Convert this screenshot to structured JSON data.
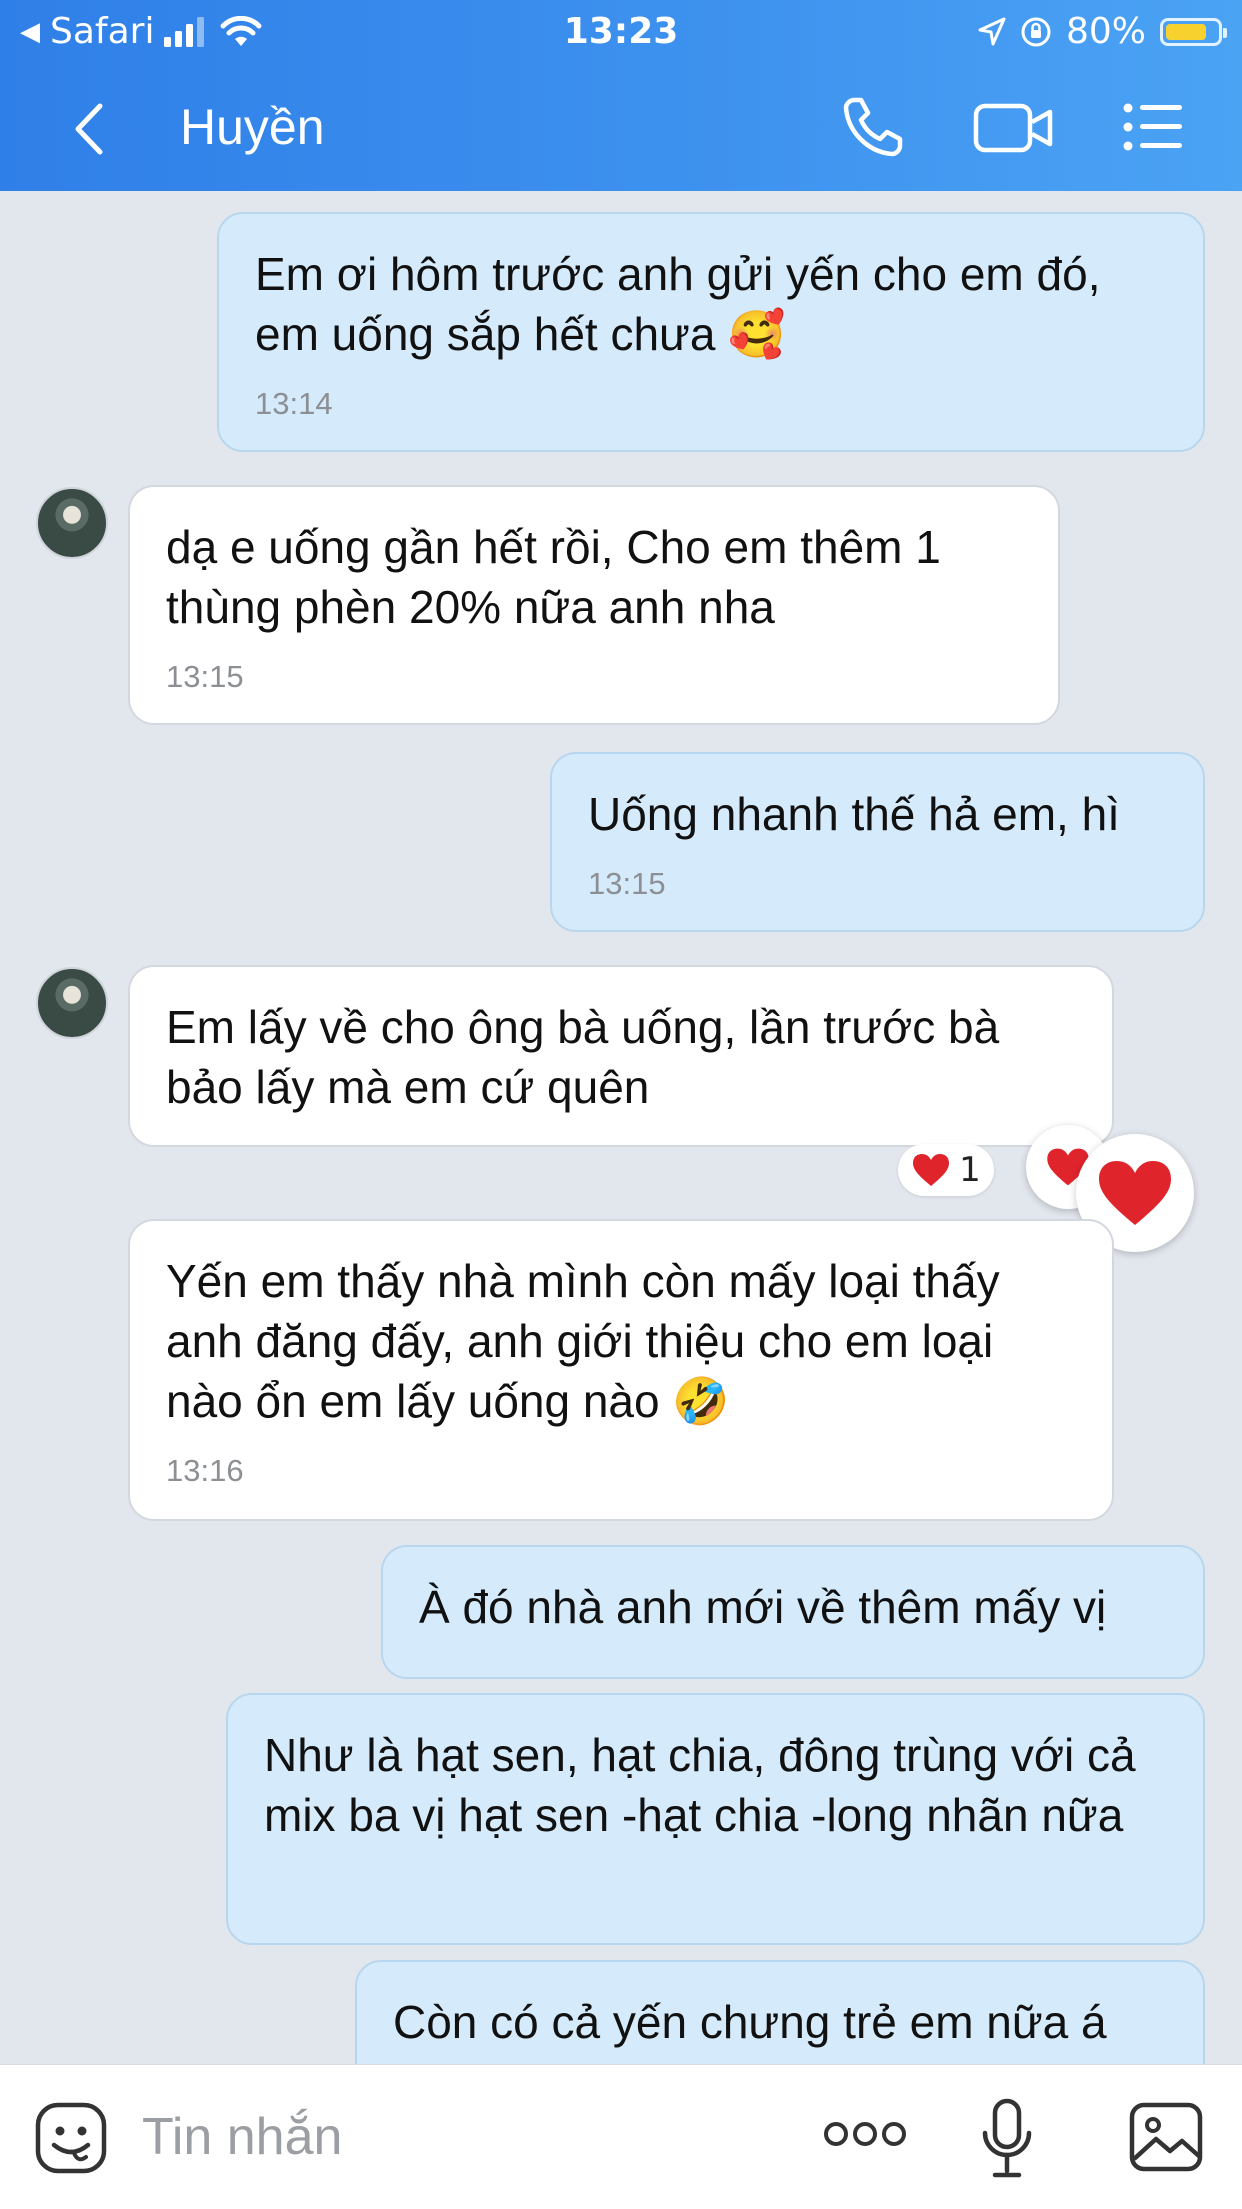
{
  "status_bar": {
    "back_app": "Safari",
    "time": "13:23",
    "battery": "80%",
    "battery_level": 0.8,
    "battery_color": "#f7d12d"
  },
  "header": {
    "contact_name": "Huyền",
    "icons": [
      "back-icon",
      "phone-icon",
      "video-call-icon",
      "menu-list-icon"
    ]
  },
  "messages": [
    {
      "direction": "out",
      "text": "Em ơi hôm trước anh gửi yến cho em đó, em uống sắp hết chưa 🥰",
      "time": "13:14"
    },
    {
      "direction": "in",
      "text": "dạ e uống gần hết rồi, Cho em thêm 1 thùng phèn 20% nữa anh nha",
      "time": "13:15"
    },
    {
      "direction": "out",
      "text": "Uống nhanh thế hả em, hì",
      "time": "13:15"
    },
    {
      "direction": "in",
      "text": "Em lấy về cho ông bà uống, lần trước bà bảo lấy mà em cứ quên",
      "time": ""
    },
    {
      "direction": "in",
      "text": "Yến em thấy nhà mình còn mấy loại thấy anh đăng đấy, anh giới thiệu cho em loại nào ổn em lấy uống nào 🤣",
      "time": "13:16"
    },
    {
      "direction": "out",
      "text": "À đó nhà anh mới về thêm mấy vị",
      "time": ""
    },
    {
      "direction": "out",
      "text": "Như là hạt sen, hạt chia, đông trùng với cả mix ba vị hạt sen -hạt chia -long nhãn nữa",
      "time": ""
    },
    {
      "direction": "out",
      "text": "Còn có cả yến chưng trẻ em nữa á",
      "time": ""
    }
  ],
  "reaction": {
    "emoji": "❤️",
    "count": "1"
  },
  "input_bar": {
    "placeholder": "Tin nhắn",
    "icons": [
      "sticker-icon",
      "more-icon",
      "microphone-icon",
      "image-icon"
    ]
  },
  "colors": {
    "header": "#3d91ee",
    "chat_background": "#e2e7ee",
    "outgoing_bubble": "#d5ebfb",
    "incoming_bubble": "#ffffff",
    "heart": "#e0242c"
  }
}
